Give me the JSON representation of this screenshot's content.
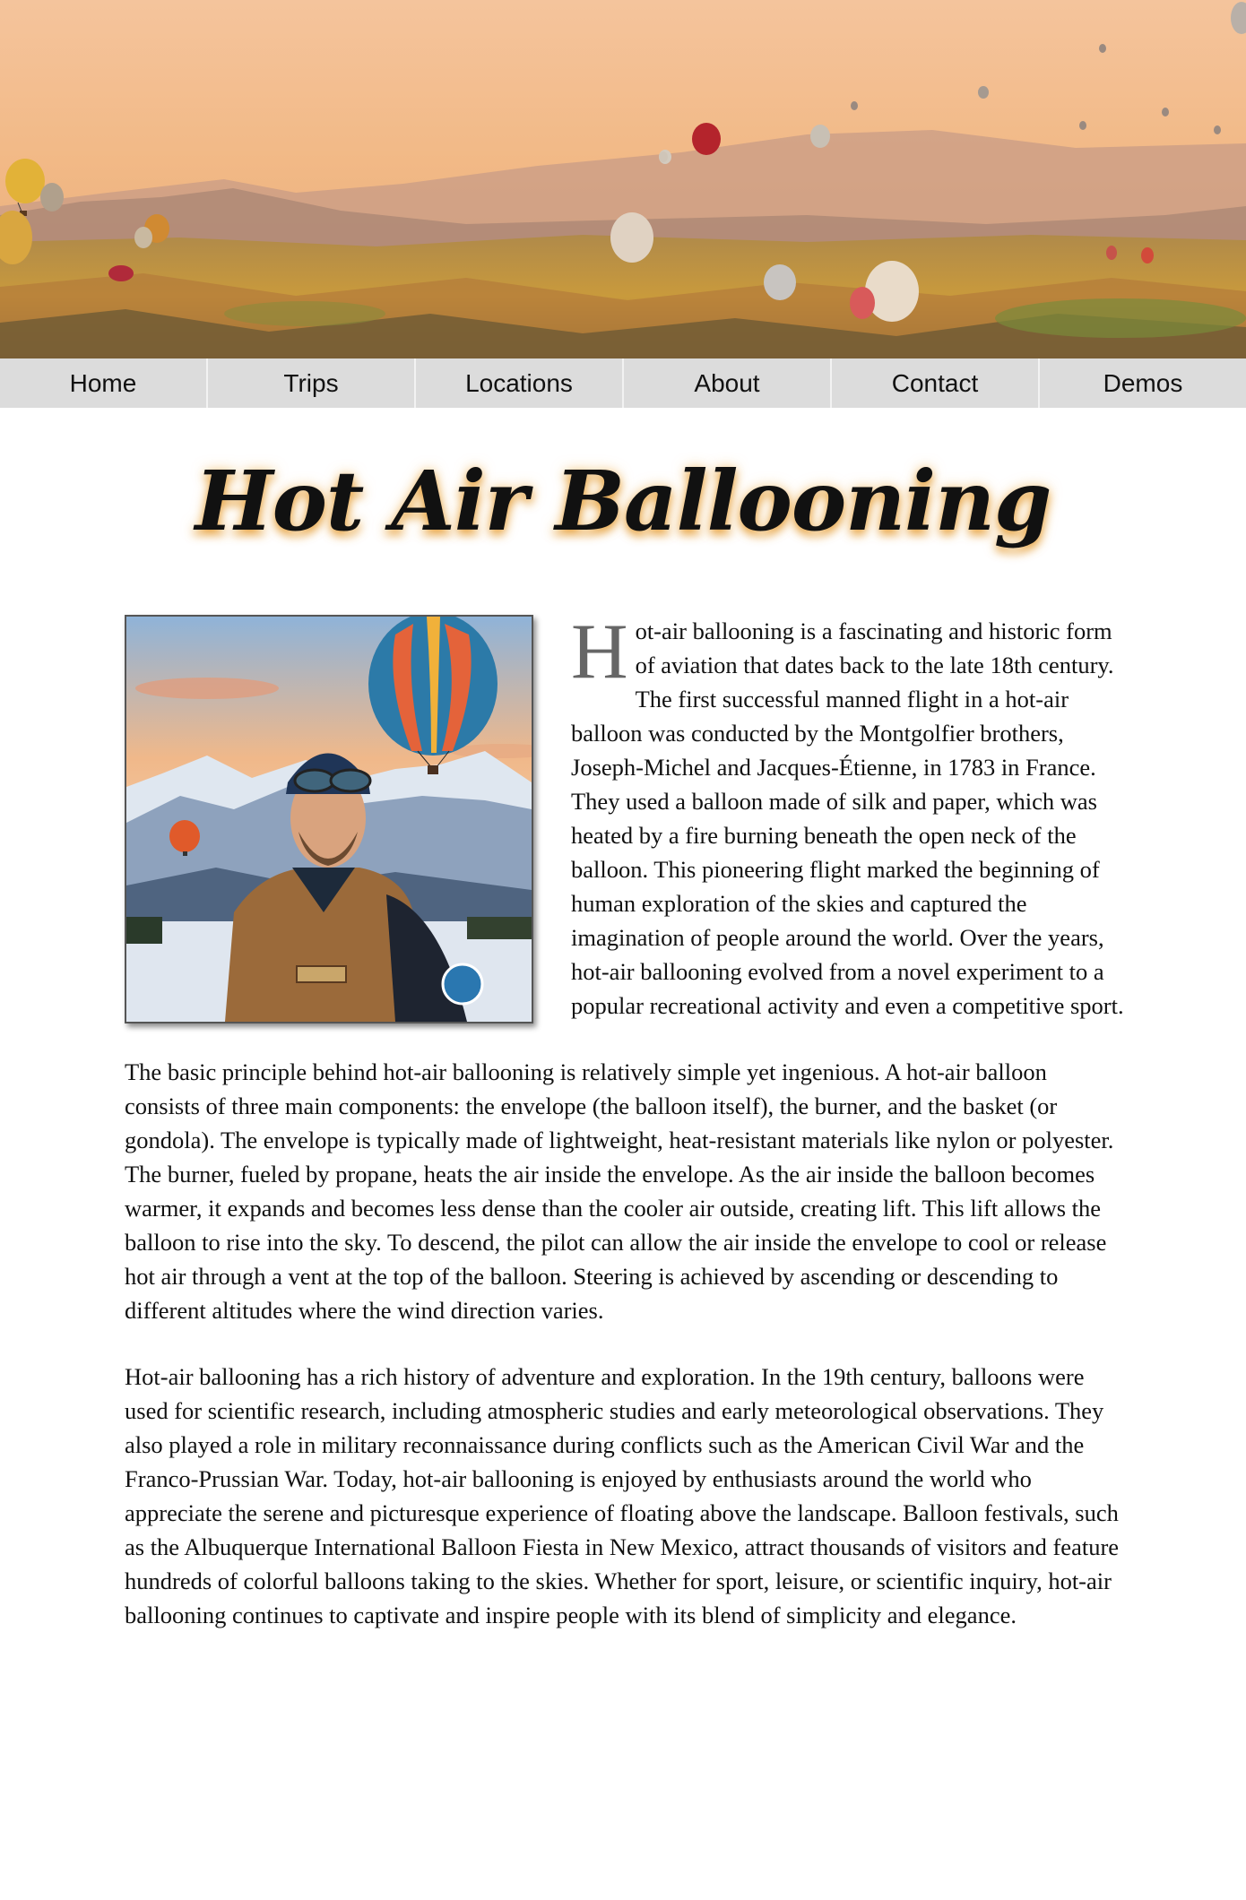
{
  "nav": {
    "items": [
      "Home",
      "Trips",
      "Locations",
      "About",
      "Contact",
      "Demos"
    ]
  },
  "page": {
    "title": "Hot Air Ballooning"
  },
  "hero": {
    "image_alt": "hot-air-balloons-over-cappadocia-landscape",
    "sky_color_top": "#f7c8a4",
    "sky_color_bottom": "#e9b07e"
  },
  "portrait": {
    "image_alt": "pilot-portrait-with-balloon-and-mountains"
  },
  "article": {
    "dropcap": "H",
    "p1_rest": "ot-air ballooning is a fascinating and historic form of aviation that dates back to the late 18th century. The first successful manned flight in a hot-air balloon was conducted by the Montgolfier brothers, Joseph-Michel and Jacques-Étienne, in 1783 in France. They used a balloon made of silk and paper, which was heated by a fire burning beneath the open neck of the balloon. This pioneering flight marked the beginning of human exploration of the skies and captured the imagination of people around the world. Over the years, hot-air ballooning evolved from a novel experiment to a popular recreational activity and even a competitive sport.",
    "p2": "The basic principle behind hot-air ballooning is relatively simple yet ingenious. A hot-air balloon consists of three main components: the envelope (the balloon itself), the burner, and the basket (or gondola). The envelope is typically made of lightweight, heat-resistant materials like nylon or polyester. The burner, fueled by propane, heats the air inside the envelope. As the air inside the balloon becomes warmer, it expands and becomes less dense than the cooler air outside, creating lift. This lift allows the balloon to rise into the sky. To descend, the pilot can allow the air inside the envelope to cool or release hot air through a vent at the top of the balloon. Steering is achieved by ascending or descending to different altitudes where the wind direction varies.",
    "p3": "Hot-air ballooning has a rich history of adventure and exploration. In the 19th century, balloons were used for scientific research, including atmospheric studies and early meteorological observations. They also played a role in military reconnaissance during conflicts such as the American Civil War and the Franco-Prussian War. Today, hot-air ballooning is enjoyed by enthusiasts around the world who appreciate the serene and picturesque experience of floating above the landscape. Balloon festivals, such as the Albuquerque International Balloon Fiesta in New Mexico, attract thousands of visitors and feature hundreds of colorful balloons taking to the skies. Whether for sport, leisure, or scientific inquiry, hot-air ballooning continues to captivate and inspire people with its blend of simplicity and elegance."
  }
}
